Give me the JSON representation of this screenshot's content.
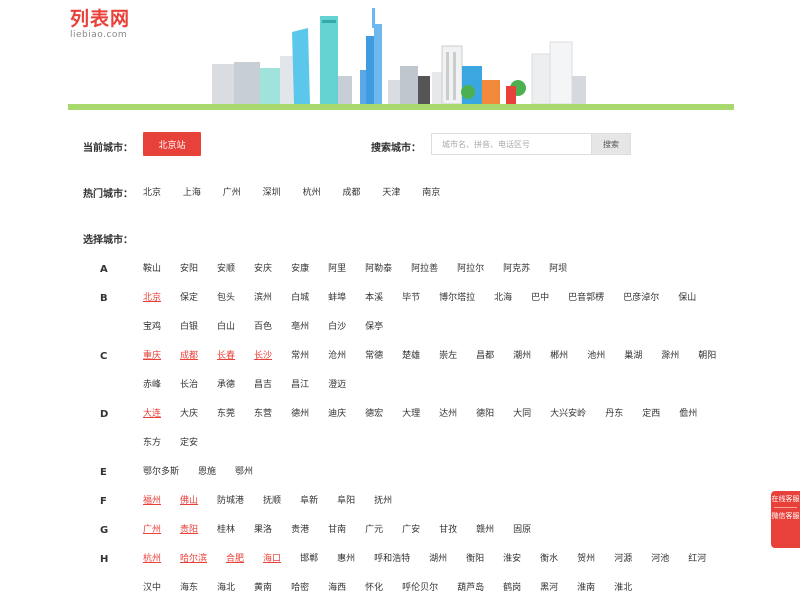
{
  "logo": {
    "main": "列表网",
    "sub": "liebiao.com"
  },
  "current": {
    "label": "当前城市：",
    "button": "北京站"
  },
  "search": {
    "label": "搜索城市：",
    "placeholder": "城市名、拼音、电话区号",
    "button": "搜索"
  },
  "hot": {
    "label": "热门城市：",
    "cities": [
      "北京",
      "上海",
      "广州",
      "深圳",
      "杭州",
      "成都",
      "天津",
      "南京"
    ]
  },
  "select_label": "选择城市：",
  "groups": [
    {
      "letter": "A",
      "cities": [
        {
          "name": "鞍山"
        },
        {
          "name": "安阳"
        },
        {
          "name": "安顺"
        },
        {
          "name": "安庆"
        },
        {
          "name": "安康"
        },
        {
          "name": "阿里"
        },
        {
          "name": "阿勒泰"
        },
        {
          "name": "阿拉善"
        },
        {
          "name": "阿拉尔"
        },
        {
          "name": "阿克苏"
        },
        {
          "name": "阿坝"
        }
      ]
    },
    {
      "letter": "B",
      "cities": [
        {
          "name": "北京",
          "hl": true
        },
        {
          "name": "保定"
        },
        {
          "name": "包头"
        },
        {
          "name": "滨州"
        },
        {
          "name": "白城"
        },
        {
          "name": "蚌埠"
        },
        {
          "name": "本溪"
        },
        {
          "name": "毕节"
        },
        {
          "name": "博尔塔拉"
        },
        {
          "name": "北海"
        },
        {
          "name": "巴中"
        },
        {
          "name": "巴音郭楞"
        },
        {
          "name": "巴彦淖尔"
        },
        {
          "name": "保山"
        },
        {
          "name": "宝鸡"
        },
        {
          "name": "白银"
        },
        {
          "name": "白山"
        },
        {
          "name": "百色"
        },
        {
          "name": "亳州"
        },
        {
          "name": "白沙"
        },
        {
          "name": "保亭"
        }
      ]
    },
    {
      "letter": "C",
      "cities": [
        {
          "name": "重庆",
          "hl": true
        },
        {
          "name": "成都",
          "hl": true
        },
        {
          "name": "长春",
          "hl": true
        },
        {
          "name": "长沙",
          "hl": true
        },
        {
          "name": "常州"
        },
        {
          "name": "沧州"
        },
        {
          "name": "常德"
        },
        {
          "name": "楚雄"
        },
        {
          "name": "崇左"
        },
        {
          "name": "昌都"
        },
        {
          "name": "潮州"
        },
        {
          "name": "郴州"
        },
        {
          "name": "池州"
        },
        {
          "name": "巢湖"
        },
        {
          "name": "滁州"
        },
        {
          "name": "朝阳"
        },
        {
          "name": "赤峰"
        },
        {
          "name": "长治"
        },
        {
          "name": "承德"
        },
        {
          "name": "昌吉"
        },
        {
          "name": "昌江"
        },
        {
          "name": "澄迈"
        }
      ]
    },
    {
      "letter": "D",
      "cities": [
        {
          "name": "大连",
          "hl": true
        },
        {
          "name": "大庆"
        },
        {
          "name": "东莞"
        },
        {
          "name": "东营"
        },
        {
          "name": "德州"
        },
        {
          "name": "迪庆"
        },
        {
          "name": "德宏"
        },
        {
          "name": "大理"
        },
        {
          "name": "达州"
        },
        {
          "name": "德阳"
        },
        {
          "name": "大同"
        },
        {
          "name": "大兴安岭"
        },
        {
          "name": "丹东"
        },
        {
          "name": "定西"
        },
        {
          "name": "儋州"
        },
        {
          "name": "东方"
        },
        {
          "name": "定安"
        }
      ]
    },
    {
      "letter": "E",
      "cities": [
        {
          "name": "鄂尔多斯"
        },
        {
          "name": "恩施"
        },
        {
          "name": "鄂州"
        }
      ]
    },
    {
      "letter": "F",
      "cities": [
        {
          "name": "福州",
          "hl": true
        },
        {
          "name": "佛山",
          "hl": true
        },
        {
          "name": "防城港"
        },
        {
          "name": "抚顺"
        },
        {
          "name": "阜新"
        },
        {
          "name": "阜阳"
        },
        {
          "name": "抚州"
        }
      ]
    },
    {
      "letter": "G",
      "cities": [
        {
          "name": "广州",
          "hl": true
        },
        {
          "name": "贵阳",
          "hl": true
        },
        {
          "name": "桂林"
        },
        {
          "name": "果洛"
        },
        {
          "name": "贵港"
        },
        {
          "name": "甘南"
        },
        {
          "name": "广元"
        },
        {
          "name": "广安"
        },
        {
          "name": "甘孜"
        },
        {
          "name": "赣州"
        },
        {
          "name": "固原"
        }
      ]
    },
    {
      "letter": "H",
      "cities": [
        {
          "name": "杭州",
          "hl": true
        },
        {
          "name": "哈尔滨",
          "hl": true
        },
        {
          "name": "合肥",
          "hl": true
        },
        {
          "name": "海口",
          "hl": true
        },
        {
          "name": "邯郸"
        },
        {
          "name": "惠州"
        },
        {
          "name": "呼和浩特"
        },
        {
          "name": "湖州"
        },
        {
          "name": "衡阳"
        },
        {
          "name": "淮安"
        },
        {
          "name": "衡水"
        },
        {
          "name": "贺州"
        },
        {
          "name": "河源"
        },
        {
          "name": "河池"
        },
        {
          "name": "红河"
        },
        {
          "name": "汉中"
        },
        {
          "name": "海东"
        },
        {
          "name": "海北"
        },
        {
          "name": "黄南"
        },
        {
          "name": "哈密"
        },
        {
          "name": "海西"
        },
        {
          "name": "怀化"
        },
        {
          "name": "呼伦贝尔"
        },
        {
          "name": "葫芦岛"
        },
        {
          "name": "鹤岗"
        },
        {
          "name": "黑河"
        },
        {
          "name": "淮南"
        },
        {
          "name": "淮北"
        }
      ]
    }
  ],
  "float_service": {
    "online": "在线客服",
    "wechat": "微信客服"
  },
  "colors": {
    "accent": "#e8413a",
    "ground": "#a9d86e"
  }
}
